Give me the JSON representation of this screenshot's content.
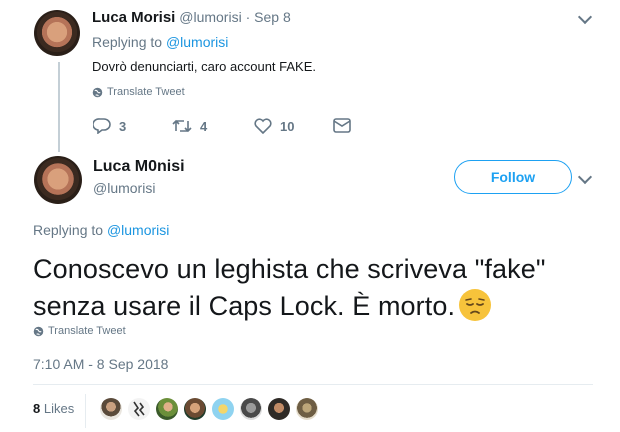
{
  "reply_tweet": {
    "name": "Luca Morisi",
    "handle": "@lumorisi",
    "separator": "·",
    "date": "Sep 8",
    "replying_prefix": "Replying to",
    "replying_handle": "@lumorisi",
    "text": "Dovrò denunciarti, caro account FAKE.",
    "translate": "Translate Tweet",
    "replies": "3",
    "retweets": "4",
    "likes": "10"
  },
  "main_tweet": {
    "name": "Luca M0nisi",
    "handle": "@lumorisi",
    "follow_label": "Follow",
    "replying_prefix": "Replying to",
    "replying_handle": "@lumorisi",
    "text_line1": "Conoscevo un leghista che scriveva \"fake\"",
    "text_line2": "senza usare il Caps Lock. È morto.",
    "emoji": "pensive-face",
    "translate": "Translate Tweet",
    "timestamp": "7:10 AM - 8 Sep 2018",
    "likes_count": "8",
    "likes_label": "Likes"
  },
  "colors": {
    "link": "#1b95e0",
    "follow": "#1da1f2",
    "muted": "#657786",
    "text": "#14171a"
  }
}
